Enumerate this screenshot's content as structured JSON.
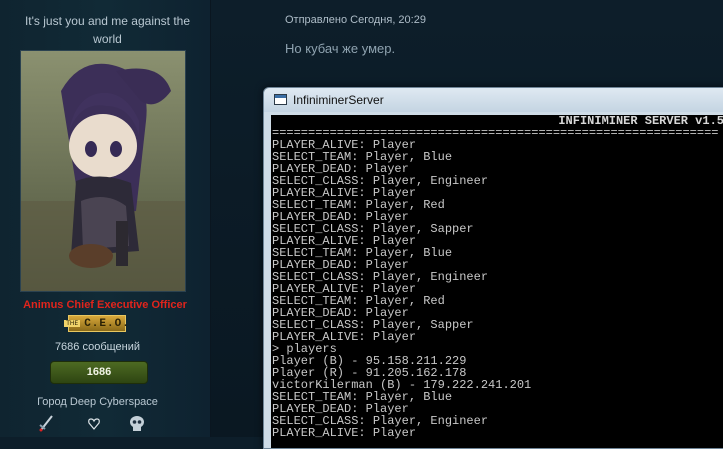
{
  "profile": {
    "status_text": "It's just you and me against the world",
    "rank_title": "Animus Chief Executive Officer",
    "badge_tag": "THE",
    "badge_text": "C.E.O.",
    "posts_count": "7686 сообщений",
    "reputation": "1686",
    "location": "Город Deep Cyberspace",
    "icons": [
      "sword-icon",
      "heart-icon",
      "skull-icon"
    ]
  },
  "post": {
    "date": "Отправлено Сегодня, 20:29",
    "text": "Но кубач же умер."
  },
  "window": {
    "title": "InfiniminerServer",
    "header": "INFINIMINER SERVER v1.5",
    "separator": "==============================================================",
    "lines": [
      "PLAYER_ALIVE: Player",
      "SELECT_TEAM: Player, Blue",
      "PLAYER_DEAD: Player",
      "SELECT_CLASS: Player, Engineer",
      "PLAYER_ALIVE: Player",
      "SELECT_TEAM: Player, Red",
      "PLAYER_DEAD: Player",
      "SELECT_CLASS: Player, Sapper",
      "PLAYER_ALIVE: Player",
      "SELECT_TEAM: Player, Blue",
      "PLAYER_DEAD: Player",
      "SELECT_CLASS: Player, Engineer",
      "PLAYER_ALIVE: Player",
      "SELECT_TEAM: Player, Red",
      "PLAYER_DEAD: Player",
      "SELECT_CLASS: Player, Sapper",
      "PLAYER_ALIVE: Player",
      "> players",
      "Player (B) - 95.158.211.229",
      "Player (R) - 91.205.162.178",
      "victorKilerman (B) - 179.222.241.201",
      "SELECT_TEAM: Player, Blue",
      "PLAYER_DEAD: Player",
      "SELECT_CLASS: Player, Engineer",
      "PLAYER_ALIVE: Player"
    ]
  }
}
